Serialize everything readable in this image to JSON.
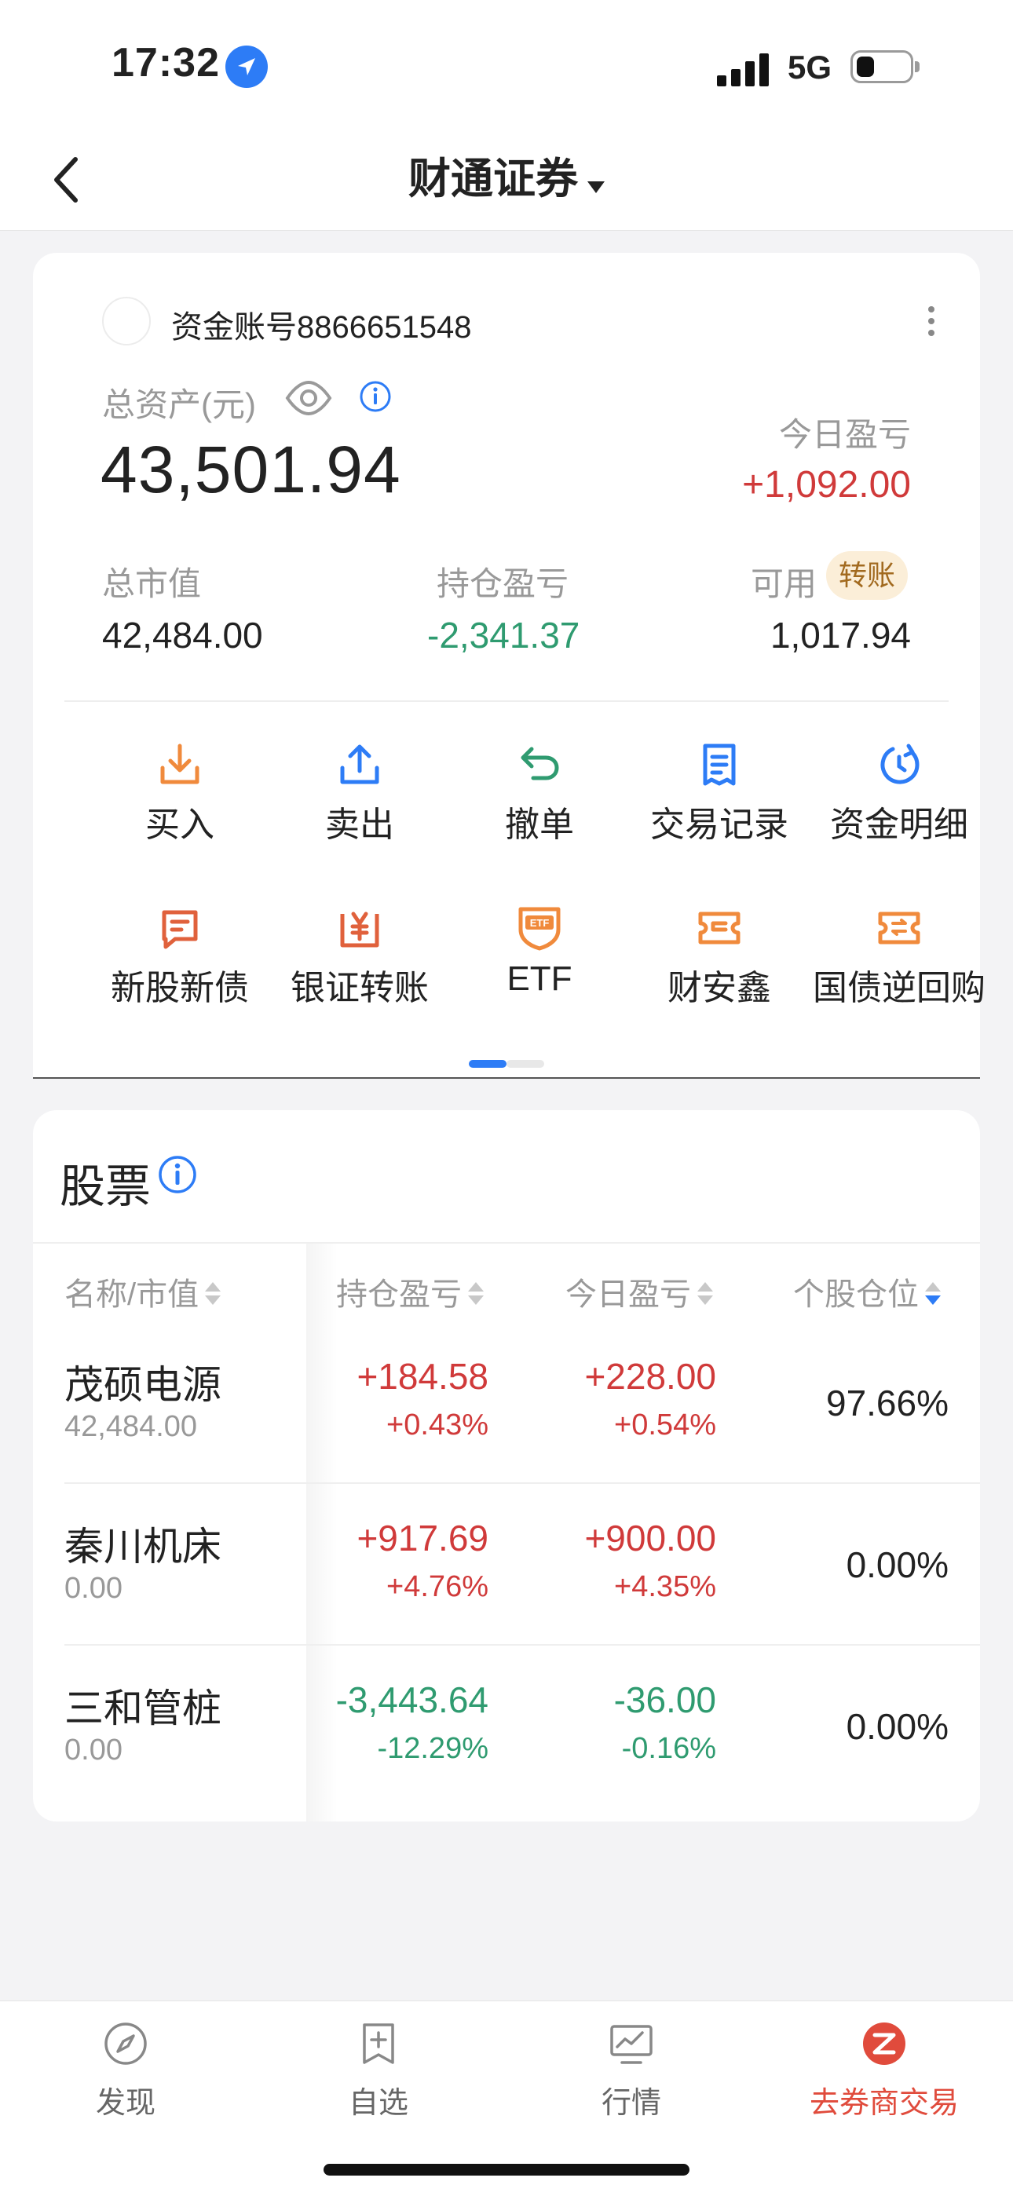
{
  "status_bar": {
    "time": "17:32",
    "network": "5G",
    "battery_level": 0.35,
    "signal_bars": 4
  },
  "nav": {
    "title": "财通证券"
  },
  "account": {
    "account_number": "资金账号8866651548",
    "total_assets_label": "总资产(元)",
    "total_assets": "43,501.94",
    "today_pl_label": "今日盈亏",
    "today_pl": "+1,092.00",
    "market_value_label": "总市值",
    "market_value": "42,484.00",
    "holding_pl_label": "持仓盈亏",
    "holding_pl": "-2,341.37",
    "available_label": "可用",
    "transfer_label": "转账",
    "available": "1,017.94"
  },
  "actions": [
    {
      "label": "买入",
      "icon": "download-icon",
      "color": "#f08a3c"
    },
    {
      "label": "卖出",
      "icon": "upload-icon",
      "color": "#2d7cf6"
    },
    {
      "label": "撤单",
      "icon": "undo-icon",
      "color": "#2f9b70"
    },
    {
      "label": "交易记录",
      "icon": "record-list-icon",
      "color": "#2d7cf6"
    },
    {
      "label": "资金明细",
      "icon": "refresh-circle-icon",
      "color": "#2d7cf6"
    },
    {
      "label": "新股新债",
      "icon": "message-doc-icon",
      "color": "#f08a3c"
    },
    {
      "label": "银证转账",
      "icon": "yen-transfer-icon",
      "color": "#e0613c"
    },
    {
      "label": "ETF",
      "icon": "etf-badge-icon",
      "color": "#f08a3c"
    },
    {
      "label": "财安鑫",
      "icon": "ticket-icon",
      "color": "#f08a3c"
    },
    {
      "label": "国债逆回购",
      "icon": "exchange-ticket-icon",
      "color": "#f08a3c"
    }
  ],
  "pager": {
    "current": 1,
    "total": 2
  },
  "stocks": {
    "title": "股票",
    "columns": [
      "名称/市值",
      "持仓盈亏",
      "今日盈亏",
      "个股仓位"
    ],
    "rows": [
      {
        "name": "茂硕电源",
        "market_value": "42,484.00",
        "hold_pl": "+184.58",
        "hold_pct": "+0.43%",
        "today_pl": "+228.00",
        "today_pct": "+0.54%",
        "position": "97.66%",
        "hold_dir": "up",
        "today_dir": "up"
      },
      {
        "name": "秦川机床",
        "market_value": "0.00",
        "hold_pl": "+917.69",
        "hold_pct": "+4.76%",
        "today_pl": "+900.00",
        "today_pct": "+4.35%",
        "position": "0.00%",
        "hold_dir": "up",
        "today_dir": "up"
      },
      {
        "name": "三和管桩",
        "market_value": "0.00",
        "hold_pl": "-3,443.64",
        "hold_pct": "-12.29%",
        "today_pl": "-36.00",
        "today_pct": "-0.16%",
        "position": "0.00%",
        "hold_dir": "down",
        "today_dir": "down"
      }
    ]
  },
  "tabbar": [
    {
      "label": "发现",
      "icon": "compass-icon"
    },
    {
      "label": "自选",
      "icon": "add-bookmark-icon"
    },
    {
      "label": "行情",
      "icon": "chart-monitor-icon"
    },
    {
      "label": "去券商交易",
      "icon": "broker-trade-icon"
    }
  ],
  "colors": {
    "up": "#d03a3a",
    "down": "#2f9b70",
    "accent": "#2d7cf6",
    "active_tab": "#e04b3c"
  }
}
